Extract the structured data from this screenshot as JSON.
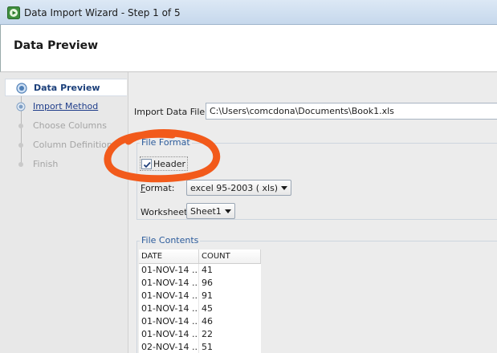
{
  "window": {
    "title": "Data Import Wizard - Step 1 of 5",
    "icon": "play-app-icon"
  },
  "header": {
    "page_title": "Data Preview"
  },
  "steps": [
    {
      "label": "Data Preview",
      "state": "active"
    },
    {
      "label": "Import Method",
      "state": "link"
    },
    {
      "label": "Choose Columns",
      "state": "disabled"
    },
    {
      "label": "Column Definition",
      "state": "disabled"
    },
    {
      "label": "Finish",
      "state": "disabled"
    }
  ],
  "import_file": {
    "label": "Import Data File:",
    "value": "C:\\Users\\comcdona\\Documents\\Book1.xls"
  },
  "file_format": {
    "legend": "File Format",
    "header_checkbox": {
      "label": "Header",
      "checked": true
    },
    "format_label_mnemonic": "F",
    "format_label_rest": "ormat:",
    "format_value": "excel 95-2003 ( xls)",
    "worksheet_label": "Worksheet",
    "worksheet_value": "Sheet1"
  },
  "file_contents": {
    "legend": "File Contents",
    "columns": [
      "DATE",
      "COUNT"
    ],
    "rows": [
      [
        "01-NOV-14 ...",
        "41"
      ],
      [
        "01-NOV-14 ...",
        "96"
      ],
      [
        "01-NOV-14 ...",
        "91"
      ],
      [
        "01-NOV-14 ...",
        "45"
      ],
      [
        "01-NOV-14 ...",
        "46"
      ],
      [
        "01-NOV-14 ...",
        "22"
      ],
      [
        "02-NOV-14 ...",
        "51"
      ]
    ]
  },
  "colors": {
    "annotation": "#f25a1b",
    "accent": "#1b3f7a",
    "legend": "#2b5b9b"
  }
}
